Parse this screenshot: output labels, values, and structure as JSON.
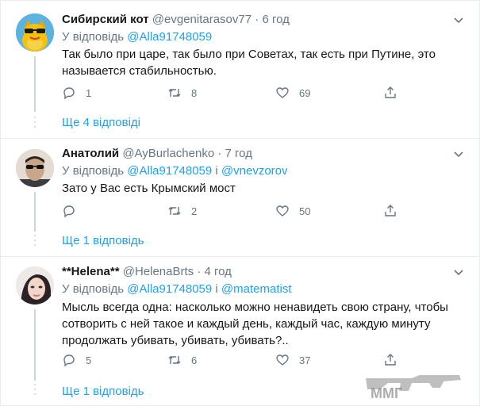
{
  "tweets": [
    {
      "name": "Сибирский кот",
      "handle": "@evgenitarasov77",
      "sep": " · ",
      "time": "6 год",
      "reply_prefix": "У відповідь ",
      "reply_mention1": "@Alla91748059",
      "reply_join": "",
      "reply_mention2": "",
      "text": "Так было при царе, так было при Советах, так есть при Путине, это называется стабильностью.",
      "replies": "1",
      "retweets": "8",
      "likes": "69",
      "more": "Ще 4 відповіді"
    },
    {
      "name": "Анатолий",
      "handle": "@AyBurlachenko",
      "sep": " · ",
      "time": "7 год",
      "reply_prefix": "У відповідь ",
      "reply_mention1": "@Alla91748059",
      "reply_join": " і ",
      "reply_mention2": "@vnevzorov",
      "text": "Зато у Вас есть Крымский мост",
      "replies": "",
      "retweets": "2",
      "likes": "50",
      "more": "Ще 1 відповідь"
    },
    {
      "name": "**Helena**",
      "handle": "@HelenaBrts",
      "sep": " · ",
      "time": "4 год",
      "reply_prefix": "У відповідь ",
      "reply_mention1": "@Alla91748059",
      "reply_join": " і ",
      "reply_mention2": "@matematist",
      "text": "Мысль всегда одна: насколько можно ненавидеть свою страну, чтобы сотворить с ней такое и каждый день, каждый час, каждую минуту продолжать убивать, убивать, убивать?..",
      "replies": "5",
      "retweets": "6",
      "likes": "37",
      "more": "Ще 1 відповідь"
    }
  ],
  "watermark": {
    "text": "ММГ"
  },
  "colors": {
    "accent": "#1da1f2",
    "muted": "#657786",
    "border": "#e6ecf0"
  },
  "icons": [
    "caret-down-icon",
    "reply-icon",
    "retweet-icon",
    "like-icon",
    "share-icon"
  ]
}
